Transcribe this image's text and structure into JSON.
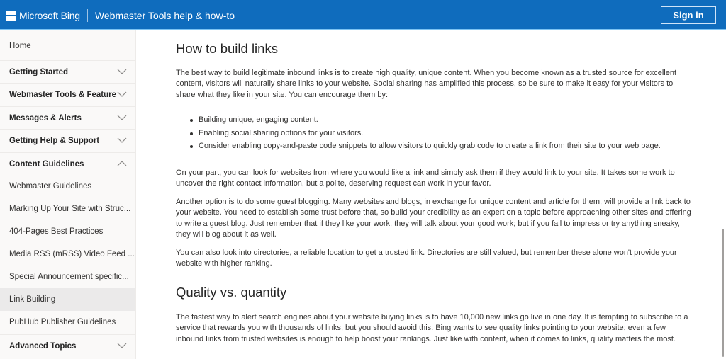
{
  "header": {
    "brand": "Microsoft Bing",
    "logo_icon": "windows-logo-icon",
    "site_title": "Webmaster Tools help & how-to",
    "signin_label": "Sign in"
  },
  "sidebar": {
    "items": [
      {
        "label": "Home",
        "type": "link"
      },
      {
        "label": "Getting Started",
        "type": "section",
        "expanded": false
      },
      {
        "label": "Webmaster Tools & Feature",
        "type": "section",
        "expanded": false
      },
      {
        "label": "Messages & Alerts",
        "type": "section",
        "expanded": false
      },
      {
        "label": "Getting Help & Support",
        "type": "section",
        "expanded": false
      },
      {
        "label": "Content Guidelines",
        "type": "section",
        "expanded": true
      },
      {
        "label": "Webmaster Guidelines",
        "type": "link"
      },
      {
        "label": "Marking Up Your Site with Struc...",
        "type": "link"
      },
      {
        "label": "404-Pages Best Practices",
        "type": "link"
      },
      {
        "label": "Media RSS (mRSS) Video Feed ...",
        "type": "link"
      },
      {
        "label": "Special Announcement specific...",
        "type": "link"
      },
      {
        "label": "Link Building",
        "type": "link",
        "selected": true
      },
      {
        "label": "PubHub Publisher Guidelines",
        "type": "link"
      },
      {
        "label": "Advanced Topics",
        "type": "section",
        "expanded": false
      }
    ]
  },
  "content": {
    "heading1": "How to build links",
    "intro": "The best way to build legitimate inbound links is to create high quality, unique content. When you become known as a trusted source for excellent content, visitors will naturally share links to your website. Social sharing has amplified this process, so be sure to make it easy for your visitors to share what they like in your site. You can encourage them by:",
    "bullets": [
      "Building unique, engaging content.",
      "Enabling social sharing options for your visitors.",
      "Consider enabling copy-and-paste code snippets to allow visitors to quickly grab code to create a link from their site to your web page."
    ],
    "para2": "On your part, you can look for websites from where you would like a link and simply ask them if they would link to your site. It takes some work to uncover the right contact information, but a polite, deserving request can work in your favor.",
    "para3": "Another option is to do some guest blogging. Many websites and blogs, in exchange for unique content and article for them, will provide a link back to your website. You need to establish some trust before that, so build your credibility as an expert on a topic before approaching other sites and offering to write a guest blog. Just remember that if they like your work, they will talk about your good work; but if you fail to impress or try anything sneaky, they will blog about it as well.",
    "para4": "You can also look into directories, a reliable location to get a trusted link. Directories are still valued, but remember these alone won't provide your website with higher ranking.",
    "heading2": "Quality vs. quantity",
    "para5": "The fastest way to alert search engines about your website buying links is to have 10,000 new links go live in one day. It is tempting to subscribe to a service that rewards you with thousands of links, but you should avoid this. Bing wants to see quality links pointing to your website; even a few inbound links from trusted websites is enough to help boost your rankings. Just like with content, when it comes to links, quality matters the most."
  },
  "colors": {
    "header_bg": "#0f6cbd",
    "sidebar_bg": "#faf9f8",
    "selected_bg": "#ebeaea"
  }
}
